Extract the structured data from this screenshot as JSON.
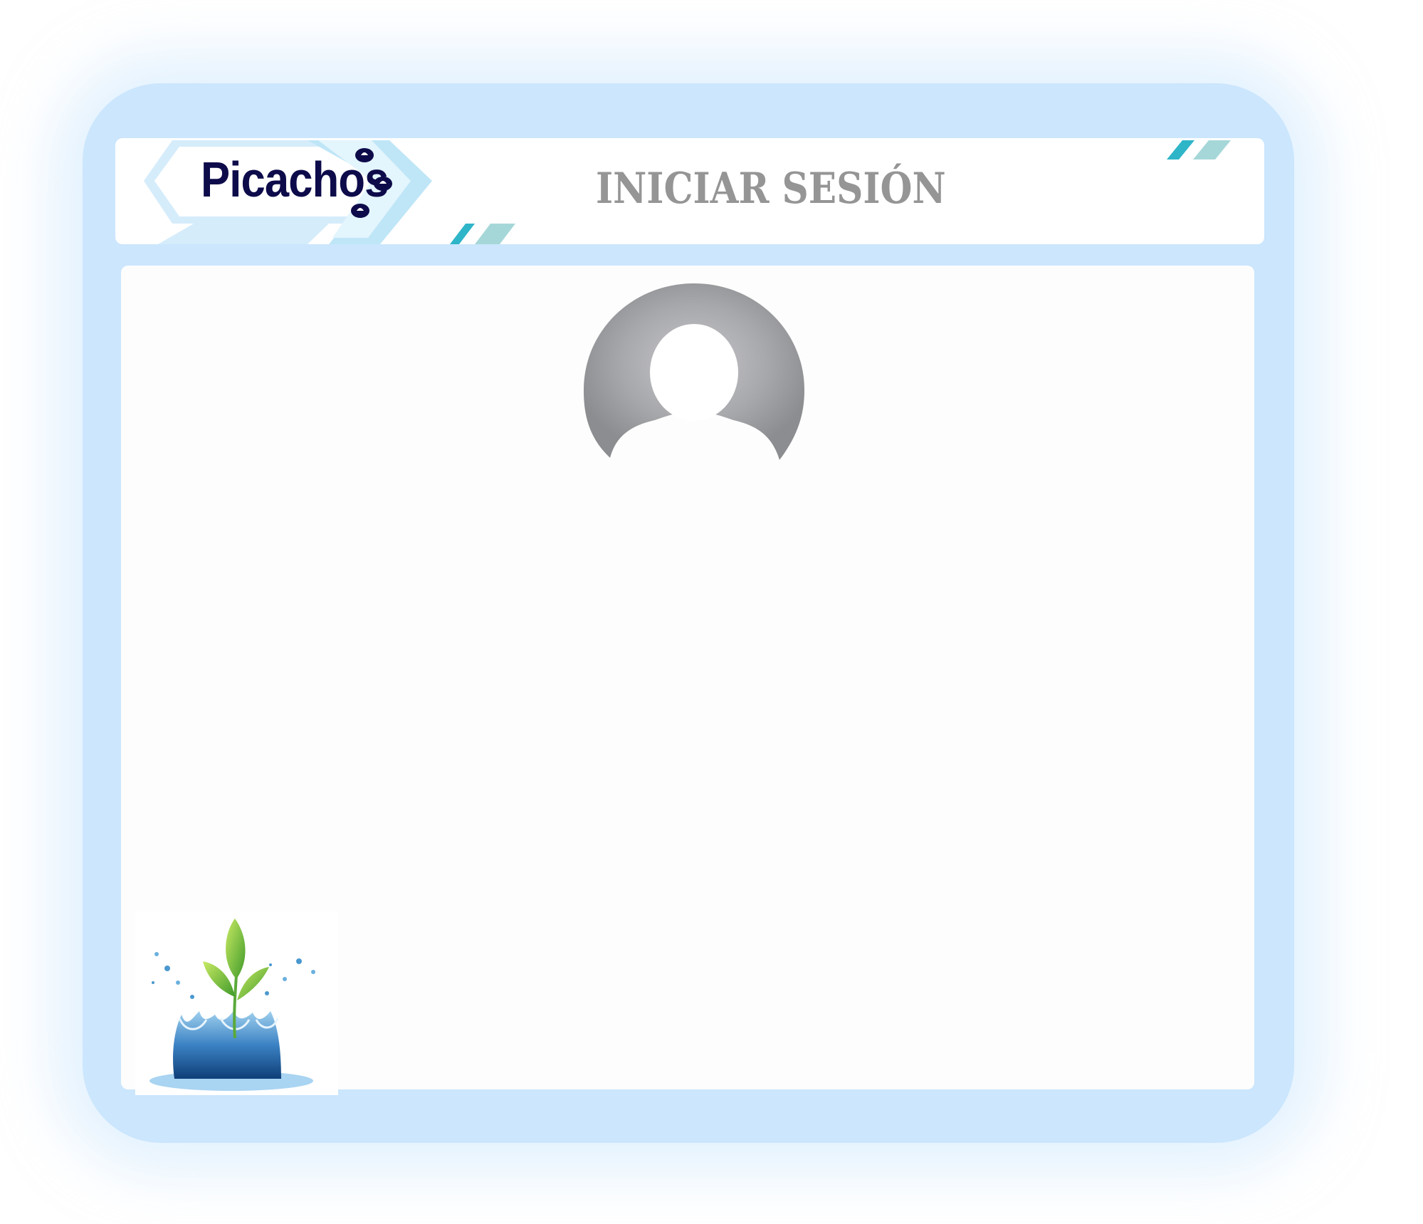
{
  "header": {
    "logo_text": "Picachos",
    "title": "INICIAR SESIÓN"
  },
  "icons": {
    "logo": "picachos-logo",
    "avatar": "user-avatar-icon",
    "plant": "water-splash-plant-image"
  },
  "colors": {
    "frame": "#cbe6fd",
    "logo_text": "#0d0b4a",
    "title": "#959595",
    "accent_teal": "#2fb5c8",
    "accent_teal_light": "#a6d7d8"
  }
}
